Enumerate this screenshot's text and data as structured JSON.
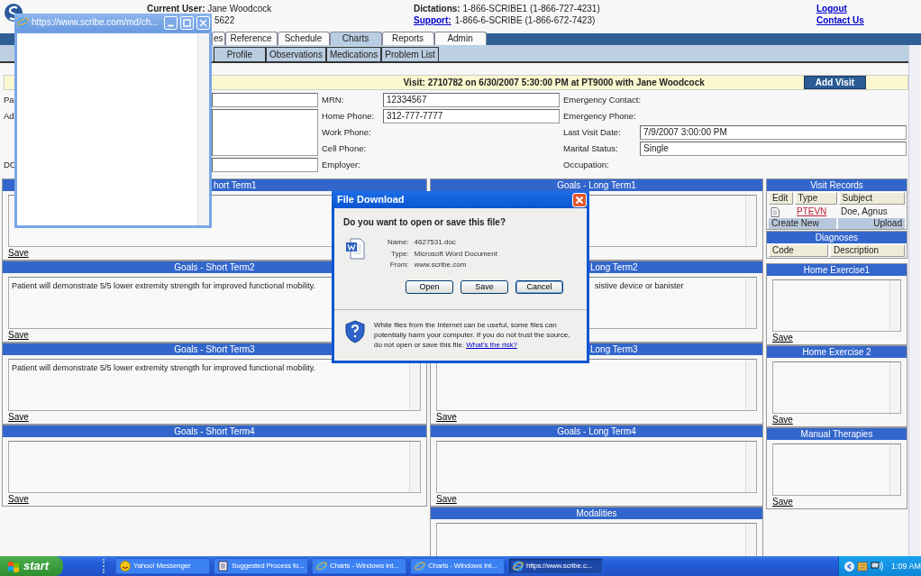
{
  "header": {
    "user": "**Current User:** Jane Woodcock",
    "user_line2": "5622",
    "dictations": "**Dictations:** 1-866-SCRIBE1 (1-866-727-4231)",
    "support_link": "Support:",
    "support": "1-866-6-SCRIBE (1-866-672-7423)",
    "links": [
      "Logout",
      "Contact Us"
    ]
  },
  "tabs": [
    {
      "label": "es",
      "selected": false
    },
    {
      "label": "Reference",
      "selected": false
    },
    {
      "label": "Schedule",
      "selected": false
    },
    {
      "label": "Charts",
      "selected": true
    },
    {
      "label": "Reports",
      "selected": false
    },
    {
      "label": "Admin",
      "selected": false
    }
  ],
  "subtabs": [
    {
      "label": "Profile",
      "selected": false
    },
    {
      "label": "Observations",
      "selected": false
    },
    {
      "label": "Medications",
      "selected": false
    },
    {
      "label": "Problem List",
      "selected": false
    }
  ],
  "visit_bar": {
    "text": "Visit: 2710782 on 6/30/2007 5:30:00 PM at PT9000 with Jane Woodcock",
    "button": "Add Visit"
  },
  "demographics": [
    [
      {
        "label": "Pa",
        "kind": "input"
      },
      {
        "label": "Ad",
        "kind": "textarea"
      },
      {
        "label": "DC",
        "kind": "input"
      }
    ],
    [
      {
        "label": "MRN:",
        "kind": "input",
        "value": "12334567"
      },
      {
        "label": "Home Phone:",
        "kind": "input",
        "value": "312-777-7777"
      },
      {
        "label": "Work Phone:",
        "kind": "label"
      },
      {
        "label": "Cell Phone:",
        "kind": "label"
      },
      {
        "label": "Employer:",
        "kind": "label"
      }
    ],
    [
      {
        "label": "Emergency Contact:",
        "kind": "label"
      },
      {
        "label": "Emergency Phone:",
        "kind": "label"
      },
      {
        "label": "Last Visit Date:",
        "kind": "input",
        "value": "7/9/2007 3:00:00 PM"
      },
      {
        "label": "Marital Status:",
        "kind": "input",
        "value": "Single"
      },
      {
        "label": "Occupation:",
        "kind": "label"
      }
    ]
  ],
  "left_panels": [
    {
      "title": "hort Term1",
      "save": "Save"
    },
    {
      "title": "Goals - Short Term2",
      "text": "Patient will demonstrate 5/5 lower extremity strength for improved functional mobility.",
      "save": "Save"
    },
    {
      "title": "Goals - Short Term3",
      "text": "Patient will demonstrate 5/5 lower extremity strength for improved functional mobility.",
      "save": "Save"
    },
    {
      "title": "Goals - Short Term4",
      "save": "Save"
    }
  ],
  "middle_panels": [
    {
      "title": "Goals - Long Term1"
    },
    {
      "title": "Long Term2",
      "text": "sistive device or banister"
    },
    {
      "title": "Long Term3",
      "save": "Save"
    },
    {
      "title": "Goals - Long Term4",
      "save": "Save"
    },
    {
      "title": "Modalities"
    }
  ],
  "visit_records": {
    "title": "Visit Records",
    "columns": [
      "Edit",
      "Type",
      "Subject"
    ],
    "rows": [
      {
        "type": "PTEVN",
        "subject": "Doe, Agnus"
      }
    ],
    "actions": [
      "Create New",
      "Upload"
    ]
  },
  "diagnoses": {
    "title": "Diagnoses",
    "columns": [
      "Code",
      "Description"
    ]
  },
  "right_panels": [
    {
      "title": "Home Exercise1",
      "save": "Save"
    },
    {
      "title": "Home Exercise 2",
      "save": "Save"
    },
    {
      "title": "Manual Therapies",
      "save": "Save"
    }
  ],
  "popup_window": {
    "title": "https://www.scribe.com/md/ch..."
  },
  "dialog": {
    "title": "File Download",
    "question": "Do you want to open or save this file?",
    "fields": [
      {
        "label": "Name:",
        "value": "4627531.doc"
      },
      {
        "label": "Type:",
        "value": "Microsoft Word Document"
      },
      {
        "label": "From:",
        "value": "www.scribe.com"
      }
    ],
    "buttons": [
      {
        "label": "Open",
        "default": false
      },
      {
        "label": "Save",
        "default": false
      },
      {
        "label": "Cancel",
        "default": true
      }
    ],
    "warning": "While files from the Internet can be useful, some files can potentially harm your computer. If you do not trust the source, do not open or save this file. ",
    "risk_link": "What's the risk?"
  },
  "taskbar": {
    "start": "start",
    "items": [
      {
        "label": "Yahoo! Messenger",
        "kind": "messenger",
        "selected": false
      },
      {
        "label": "Suggested Process fo...",
        "kind": "document",
        "selected": false
      },
      {
        "label": "Charts - Windows Int...",
        "kind": "browser",
        "selected": false
      },
      {
        "label": "Charts - Windows Int...",
        "kind": "browser",
        "selected": false
      },
      {
        "label": "https://www.scribe.c...",
        "kind": "browser",
        "selected": true
      }
    ],
    "clock": "1:09 AM"
  }
}
